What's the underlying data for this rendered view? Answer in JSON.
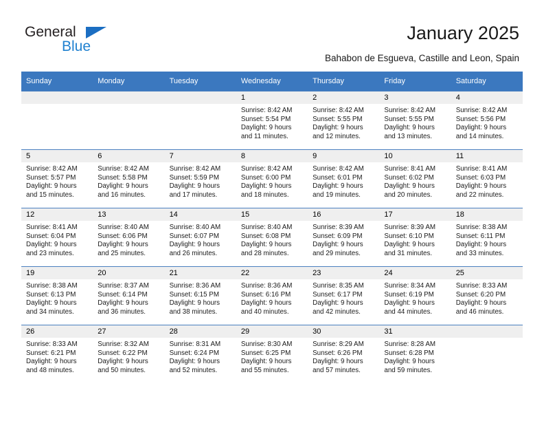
{
  "brand": {
    "name_part1": "General",
    "name_part2": "Blue",
    "triangle_color": "#1b6ec2",
    "blue_color": "#2081d0"
  },
  "header": {
    "title": "January 2025",
    "subtitle": "Bahabon de Esgueva, Castille and Leon, Spain"
  },
  "theme": {
    "header_blue": "#3b78bf",
    "row_divider": "#4a7fbf",
    "daynum_band": "#efefef"
  },
  "calendar": {
    "weekday_headers": [
      "Sunday",
      "Monday",
      "Tuesday",
      "Wednesday",
      "Thursday",
      "Friday",
      "Saturday"
    ],
    "weeks": [
      [
        {
          "day": "",
          "empty": true
        },
        {
          "day": "",
          "empty": true
        },
        {
          "day": "",
          "empty": true
        },
        {
          "day": "1",
          "sunrise": "Sunrise: 8:42 AM",
          "sunset": "Sunset: 5:54 PM",
          "daylight1": "Daylight: 9 hours",
          "daylight2": "and 11 minutes."
        },
        {
          "day": "2",
          "sunrise": "Sunrise: 8:42 AM",
          "sunset": "Sunset: 5:55 PM",
          "daylight1": "Daylight: 9 hours",
          "daylight2": "and 12 minutes."
        },
        {
          "day": "3",
          "sunrise": "Sunrise: 8:42 AM",
          "sunset": "Sunset: 5:55 PM",
          "daylight1": "Daylight: 9 hours",
          "daylight2": "and 13 minutes."
        },
        {
          "day": "4",
          "sunrise": "Sunrise: 8:42 AM",
          "sunset": "Sunset: 5:56 PM",
          "daylight1": "Daylight: 9 hours",
          "daylight2": "and 14 minutes."
        }
      ],
      [
        {
          "day": "5",
          "sunrise": "Sunrise: 8:42 AM",
          "sunset": "Sunset: 5:57 PM",
          "daylight1": "Daylight: 9 hours",
          "daylight2": "and 15 minutes."
        },
        {
          "day": "6",
          "sunrise": "Sunrise: 8:42 AM",
          "sunset": "Sunset: 5:58 PM",
          "daylight1": "Daylight: 9 hours",
          "daylight2": "and 16 minutes."
        },
        {
          "day": "7",
          "sunrise": "Sunrise: 8:42 AM",
          "sunset": "Sunset: 5:59 PM",
          "daylight1": "Daylight: 9 hours",
          "daylight2": "and 17 minutes."
        },
        {
          "day": "8",
          "sunrise": "Sunrise: 8:42 AM",
          "sunset": "Sunset: 6:00 PM",
          "daylight1": "Daylight: 9 hours",
          "daylight2": "and 18 minutes."
        },
        {
          "day": "9",
          "sunrise": "Sunrise: 8:42 AM",
          "sunset": "Sunset: 6:01 PM",
          "daylight1": "Daylight: 9 hours",
          "daylight2": "and 19 minutes."
        },
        {
          "day": "10",
          "sunrise": "Sunrise: 8:41 AM",
          "sunset": "Sunset: 6:02 PM",
          "daylight1": "Daylight: 9 hours",
          "daylight2": "and 20 minutes."
        },
        {
          "day": "11",
          "sunrise": "Sunrise: 8:41 AM",
          "sunset": "Sunset: 6:03 PM",
          "daylight1": "Daylight: 9 hours",
          "daylight2": "and 22 minutes."
        }
      ],
      [
        {
          "day": "12",
          "sunrise": "Sunrise: 8:41 AM",
          "sunset": "Sunset: 6:04 PM",
          "daylight1": "Daylight: 9 hours",
          "daylight2": "and 23 minutes."
        },
        {
          "day": "13",
          "sunrise": "Sunrise: 8:40 AM",
          "sunset": "Sunset: 6:06 PM",
          "daylight1": "Daylight: 9 hours",
          "daylight2": "and 25 minutes."
        },
        {
          "day": "14",
          "sunrise": "Sunrise: 8:40 AM",
          "sunset": "Sunset: 6:07 PM",
          "daylight1": "Daylight: 9 hours",
          "daylight2": "and 26 minutes."
        },
        {
          "day": "15",
          "sunrise": "Sunrise: 8:40 AM",
          "sunset": "Sunset: 6:08 PM",
          "daylight1": "Daylight: 9 hours",
          "daylight2": "and 28 minutes."
        },
        {
          "day": "16",
          "sunrise": "Sunrise: 8:39 AM",
          "sunset": "Sunset: 6:09 PM",
          "daylight1": "Daylight: 9 hours",
          "daylight2": "and 29 minutes."
        },
        {
          "day": "17",
          "sunrise": "Sunrise: 8:39 AM",
          "sunset": "Sunset: 6:10 PM",
          "daylight1": "Daylight: 9 hours",
          "daylight2": "and 31 minutes."
        },
        {
          "day": "18",
          "sunrise": "Sunrise: 8:38 AM",
          "sunset": "Sunset: 6:11 PM",
          "daylight1": "Daylight: 9 hours",
          "daylight2": "and 33 minutes."
        }
      ],
      [
        {
          "day": "19",
          "sunrise": "Sunrise: 8:38 AM",
          "sunset": "Sunset: 6:13 PM",
          "daylight1": "Daylight: 9 hours",
          "daylight2": "and 34 minutes."
        },
        {
          "day": "20",
          "sunrise": "Sunrise: 8:37 AM",
          "sunset": "Sunset: 6:14 PM",
          "daylight1": "Daylight: 9 hours",
          "daylight2": "and 36 minutes."
        },
        {
          "day": "21",
          "sunrise": "Sunrise: 8:36 AM",
          "sunset": "Sunset: 6:15 PM",
          "daylight1": "Daylight: 9 hours",
          "daylight2": "and 38 minutes."
        },
        {
          "day": "22",
          "sunrise": "Sunrise: 8:36 AM",
          "sunset": "Sunset: 6:16 PM",
          "daylight1": "Daylight: 9 hours",
          "daylight2": "and 40 minutes."
        },
        {
          "day": "23",
          "sunrise": "Sunrise: 8:35 AM",
          "sunset": "Sunset: 6:17 PM",
          "daylight1": "Daylight: 9 hours",
          "daylight2": "and 42 minutes."
        },
        {
          "day": "24",
          "sunrise": "Sunrise: 8:34 AM",
          "sunset": "Sunset: 6:19 PM",
          "daylight1": "Daylight: 9 hours",
          "daylight2": "and 44 minutes."
        },
        {
          "day": "25",
          "sunrise": "Sunrise: 8:33 AM",
          "sunset": "Sunset: 6:20 PM",
          "daylight1": "Daylight: 9 hours",
          "daylight2": "and 46 minutes."
        }
      ],
      [
        {
          "day": "26",
          "sunrise": "Sunrise: 8:33 AM",
          "sunset": "Sunset: 6:21 PM",
          "daylight1": "Daylight: 9 hours",
          "daylight2": "and 48 minutes."
        },
        {
          "day": "27",
          "sunrise": "Sunrise: 8:32 AM",
          "sunset": "Sunset: 6:22 PM",
          "daylight1": "Daylight: 9 hours",
          "daylight2": "and 50 minutes."
        },
        {
          "day": "28",
          "sunrise": "Sunrise: 8:31 AM",
          "sunset": "Sunset: 6:24 PM",
          "daylight1": "Daylight: 9 hours",
          "daylight2": "and 52 minutes."
        },
        {
          "day": "29",
          "sunrise": "Sunrise: 8:30 AM",
          "sunset": "Sunset: 6:25 PM",
          "daylight1": "Daylight: 9 hours",
          "daylight2": "and 55 minutes."
        },
        {
          "day": "30",
          "sunrise": "Sunrise: 8:29 AM",
          "sunset": "Sunset: 6:26 PM",
          "daylight1": "Daylight: 9 hours",
          "daylight2": "and 57 minutes."
        },
        {
          "day": "31",
          "sunrise": "Sunrise: 8:28 AM",
          "sunset": "Sunset: 6:28 PM",
          "daylight1": "Daylight: 9 hours",
          "daylight2": "and 59 minutes."
        },
        {
          "day": "",
          "empty": true
        }
      ]
    ]
  }
}
